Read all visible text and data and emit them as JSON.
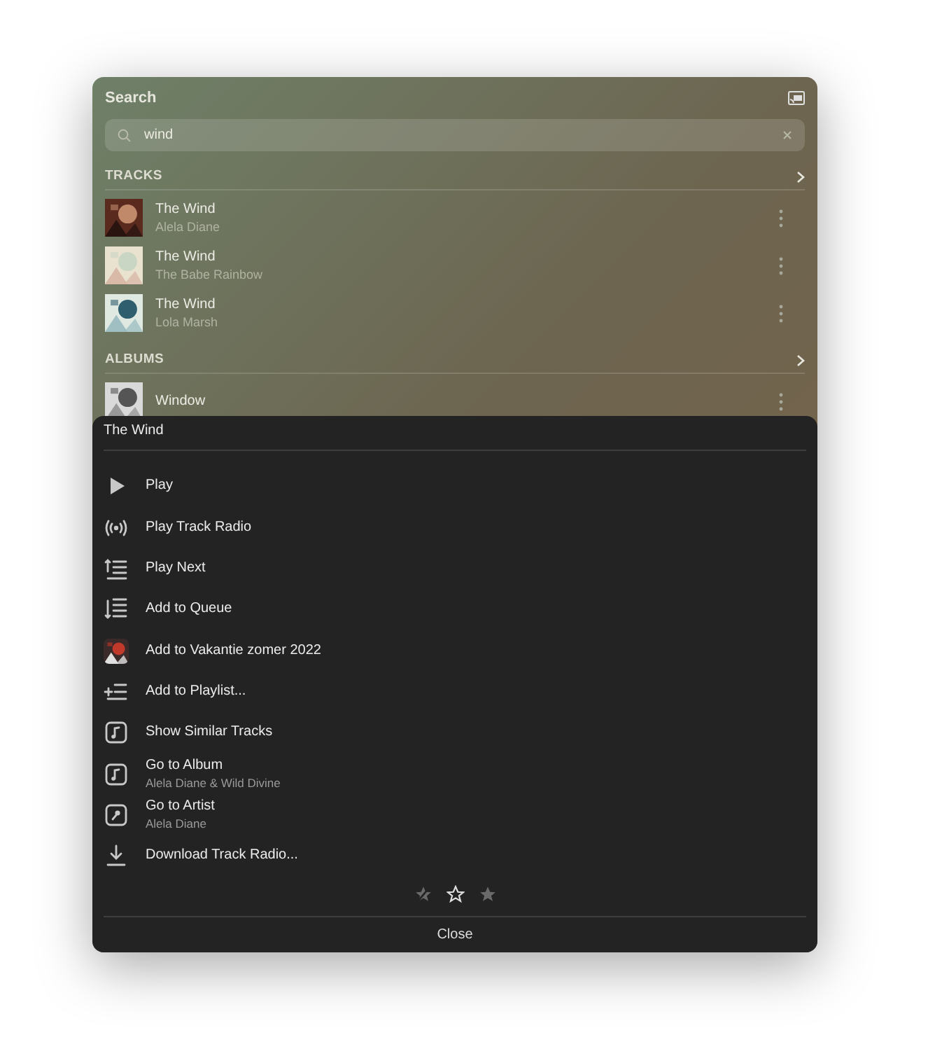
{
  "header": {
    "title": "Search"
  },
  "search": {
    "value": "wind"
  },
  "sections": [
    {
      "title": "TRACKS",
      "items": [
        {
          "title": "The Wind",
          "subtitle": "Alela Diane",
          "kind": "picture"
        },
        {
          "title": "The Wind",
          "subtitle": "The Babe Rainbow",
          "kind": "picture"
        },
        {
          "title": "The Wind",
          "subtitle": "Lola Marsh",
          "kind": "picture"
        }
      ]
    },
    {
      "title": "ALBUMS",
      "items": [
        {
          "title": "Window",
          "kind": "picture"
        }
      ]
    }
  ],
  "sheet": {
    "title": "The Wind",
    "items": [
      {
        "kind": "play",
        "label": "Play"
      },
      {
        "kind": "radio",
        "label": "Play Track Radio"
      },
      {
        "kind": "play-next",
        "label": "Play Next"
      },
      {
        "kind": "queue",
        "label": "Add to Queue"
      },
      {
        "kind": "picture",
        "label": "Add to Vakantie zomer 2022"
      },
      {
        "kind": "add-list",
        "label": "Add to Playlist..."
      },
      {
        "kind": "note",
        "label": "Show Similar Tracks"
      },
      {
        "kind": "note",
        "label": "Go to Album",
        "subtitle": "Alela Diane & Wild Divine"
      },
      {
        "kind": "artist",
        "label": "Go to Artist",
        "subtitle": "Alela Diane"
      },
      {
        "kind": "download",
        "label": "Download Track Radio..."
      }
    ],
    "close": "Close"
  }
}
